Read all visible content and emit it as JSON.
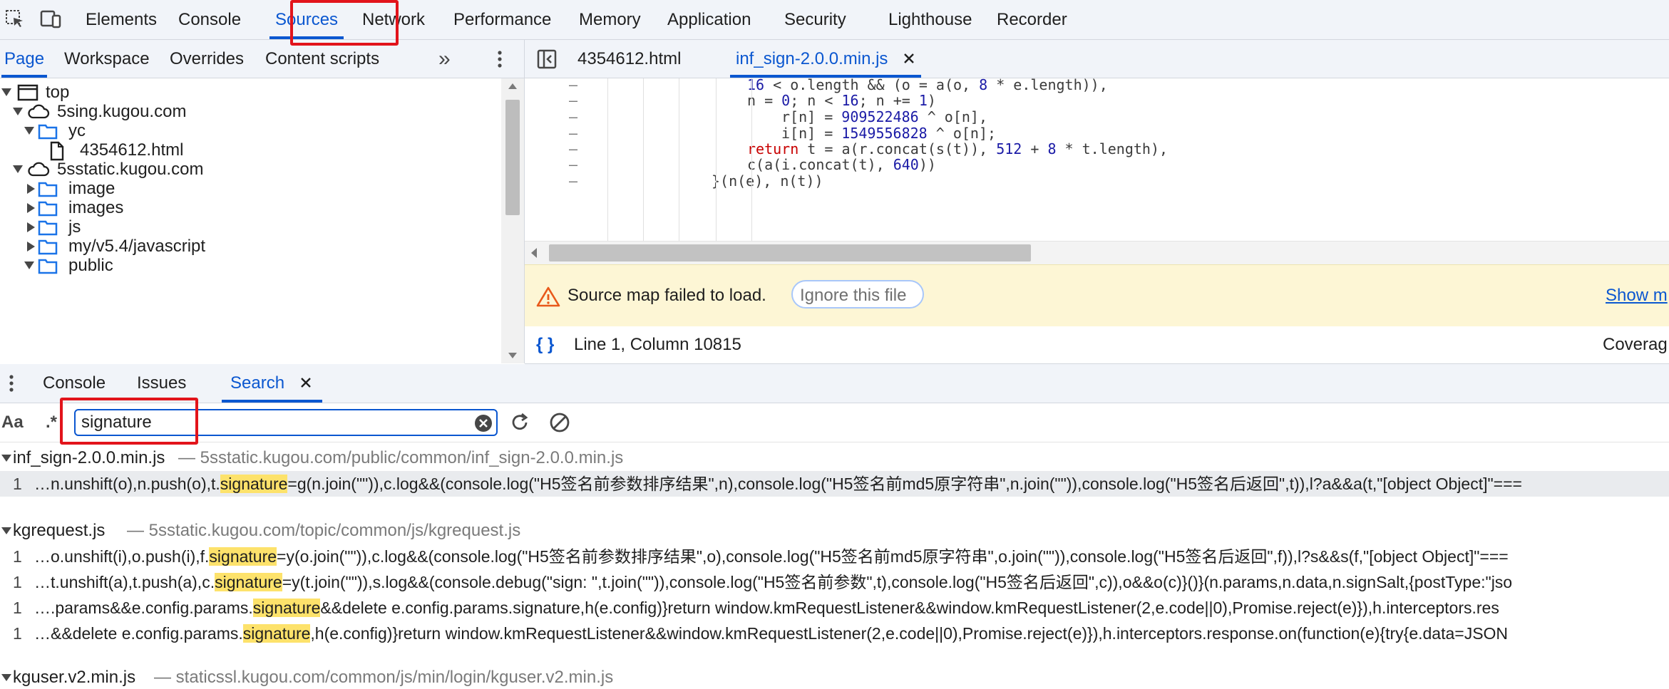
{
  "top_tabs": [
    "Elements",
    "Console",
    "Sources",
    "Network",
    "Performance",
    "Memory",
    "Application",
    "Security",
    "Lighthouse",
    "Recorder"
  ],
  "active_top_tab": "Sources",
  "navigator": {
    "tabs": [
      "Page",
      "Workspace",
      "Overrides",
      "Content scripts"
    ],
    "active": "Page",
    "more_label": "»"
  },
  "tree": [
    {
      "label": "top",
      "icon": "frame-icon"
    },
    {
      "label": "5sing.kugou.com",
      "icon": "cloud-icon"
    },
    {
      "label": "yc",
      "icon": "folder-icon"
    },
    {
      "label": "4354612.html",
      "icon": "file-icon"
    },
    {
      "label": "5sstatic.kugou.com",
      "icon": "cloud-icon"
    },
    {
      "label": "image",
      "icon": "folder-icon"
    },
    {
      "label": "images",
      "icon": "folder-icon"
    },
    {
      "label": "js",
      "icon": "folder-icon"
    },
    {
      "label": "my/v5.4/javascript",
      "icon": "folder-icon"
    },
    {
      "label": "public",
      "icon": "folder-icon"
    }
  ],
  "editor": {
    "tabs": [
      "4354612.html",
      "inf_sign-2.0.0.min.js"
    ],
    "active": "inf_sign-2.0.0.min.js",
    "lines": [
      {
        "gutter": "–",
        "parts": [
          [
            "num",
            "16"
          ],
          [
            "t",
            " < o.length && (o = a(o, "
          ],
          [
            "num",
            "8"
          ],
          [
            "t",
            " * e.length)),"
          ]
        ]
      },
      {
        "gutter": "–",
        "parts": [
          [
            "t",
            "n = "
          ],
          [
            "num",
            "0"
          ],
          [
            "t",
            "; n < "
          ],
          [
            "num",
            "16"
          ],
          [
            "t",
            "; n += "
          ],
          [
            "num",
            "1"
          ],
          [
            "t",
            ")"
          ]
        ]
      },
      {
        "gutter": "–",
        "parts": [
          [
            "t",
            "r[n] = "
          ],
          [
            "num",
            "909522486"
          ],
          [
            "t",
            " ^ o[n],"
          ]
        ]
      },
      {
        "gutter": "–",
        "parts": [
          [
            "t",
            "i[n] = "
          ],
          [
            "num",
            "1549556828"
          ],
          [
            "t",
            " ^ o[n];"
          ]
        ]
      },
      {
        "gutter": "–",
        "parts": [
          [
            "kw",
            "return"
          ],
          [
            "t",
            " t = a(r.concat(s(t)), "
          ],
          [
            "num",
            "512"
          ],
          [
            "t",
            " + "
          ],
          [
            "num",
            "8"
          ],
          [
            "t",
            " * t.length),"
          ]
        ]
      },
      {
        "gutter": "–",
        "parts": [
          [
            "t",
            "c(a(i.concat(t), "
          ],
          [
            "num",
            "640"
          ],
          [
            "t",
            "))"
          ]
        ]
      },
      {
        "gutter": "–",
        "parts": [
          [
            "t",
            "}(n(e), n(t))"
          ]
        ]
      }
    ]
  },
  "warning": {
    "text": "Source map failed to load.",
    "ignore_label": "Ignore this file",
    "show_more": "Show m"
  },
  "status": {
    "location": "Line 1, Column 10815",
    "coverage": "Coverag"
  },
  "drawer": {
    "tabs": [
      "Console",
      "Issues",
      "Search"
    ],
    "active": "Search"
  },
  "search": {
    "case_label": "Aa",
    "regex_label": ".*",
    "query": "signature"
  },
  "results": [
    {
      "file": "inf_sign-2.0.0.min.js",
      "path": "5sstatic.kugou.com/public/common/inf_sign-2.0.0.min.js",
      "matches": [
        {
          "line": "1",
          "pre": "…n.unshift(o),n.push(o),t.",
          "hit": "signature",
          "post": "=g(n.join(\"\")),c.log&&(console.log(\"H5签名前参数排序结果\",n),console.log(\"H5签名前md5原字符串\",n.join(\"\")),console.log(\"H5签名后返回\",t)),l?a&&a(t,\"[object Object]\"==="
        }
      ]
    },
    {
      "file": "kgrequest.js",
      "path": "5sstatic.kugou.com/topic/common/js/kgrequest.js",
      "matches": [
        {
          "line": "1",
          "pre": "…o.unshift(i),o.push(i),f.",
          "hit": "signature",
          "post": "=y(o.join(\"\")),c.log&&(console.log(\"H5签名前参数排序结果\",o),console.log(\"H5签名前md5原字符串\",o.join(\"\")),console.log(\"H5签名后返回\",f)),l?s&&s(f,\"[object Object]\"==="
        },
        {
          "line": "1",
          "pre": "…t.unshift(a),t.push(a),c.",
          "hit": "signature",
          "post": "=y(t.join(\"\")),s.log&&(console.debug(\"sign: \",t.join(\"\")),console.log(\"H5签名前参数\",t),console.log(\"H5签名后返回\",c)),o&&o(c)}()}(n.params,n.data,n.signSalt,{postType:\"jso"
        },
        {
          "line": "1",
          "pre": "….params&&e.config.params.",
          "hit": "signature",
          "post": "&&delete e.config.params.signature,h(e.config)}return window.kmRequestListener&&window.kmRequestListener(2,e.code||0),Promise.reject(e)}),h.interceptors.res"
        },
        {
          "line": "1",
          "pre": "…&&delete e.config.params.",
          "hit": "signature",
          "post": ",h(e.config)}return window.kmRequestListener&&window.kmRequestListener(2,e.code||0),Promise.reject(e)}),h.interceptors.response.on(function(e){try{e.data=JSON"
        }
      ]
    },
    {
      "file": "kguser.v2.min.js",
      "path": "staticssl.kugou.com/common/js/min/login/kguser.v2.min.js",
      "matches": []
    }
  ]
}
